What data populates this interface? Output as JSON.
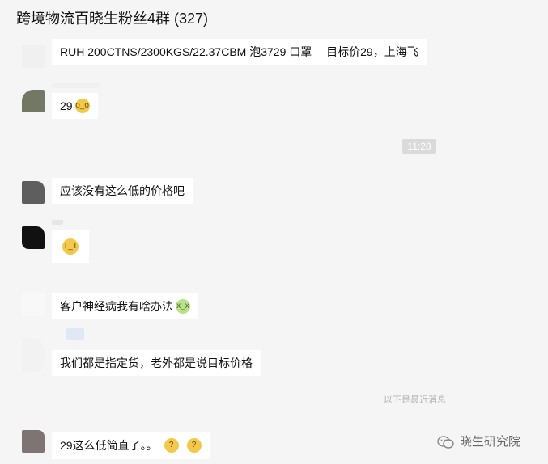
{
  "header": {
    "title": "跨境物流百晓生粉丝4群 (327)"
  },
  "messages": [
    {
      "text": "RUH 200CTNS/2300KGS/22.37CBM 泡3729 口罩　 目标价29，上海飞"
    },
    {
      "text": "29",
      "emoji": "flushed-face"
    },
    {
      "text": "应该没有这么低的价格吧"
    },
    {
      "emoji": "crying-face"
    },
    {
      "text": "客户神经病我有啥办法",
      "emoji": "nauseated-face"
    },
    {
      "text": "我们都是指定货，老外都是说目标价格"
    },
    {
      "text": "29这么低简直了。。",
      "emoji": "thinking-face"
    }
  ],
  "timestamp": "11:28",
  "divider": "以下是最近消息",
  "watermark": "晓生研究院",
  "colors": {
    "background": "#f5f5f5",
    "bubble": "#ffffff",
    "time_badge": "#dadada"
  }
}
